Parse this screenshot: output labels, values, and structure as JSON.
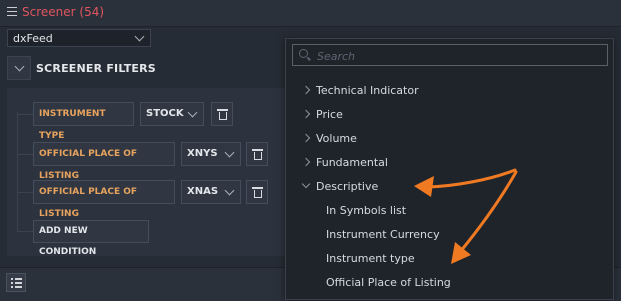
{
  "header": {
    "title": "Screener (54)"
  },
  "source": {
    "selected": "dxFeed"
  },
  "section": {
    "title": "SCREENER FILTERS"
  },
  "conditions": [
    {
      "field": "INSTRUMENT TYPE",
      "value": "STOCK"
    },
    {
      "field": "OFFICIAL PLACE OF LISTING",
      "value": "XNYS"
    },
    {
      "field": "OFFICIAL PLACE OF LISTING",
      "value": "XNAS"
    }
  ],
  "add_condition_label": "ADD NEW CONDITION",
  "dropdown": {
    "search_placeholder": "Search",
    "categories": [
      {
        "label": "Technical Indicator",
        "expanded": false
      },
      {
        "label": "Price",
        "expanded": false
      },
      {
        "label": "Volume",
        "expanded": false
      },
      {
        "label": "Fundamental",
        "expanded": false
      },
      {
        "label": "Descriptive",
        "expanded": true
      }
    ],
    "sub_items": [
      {
        "label": "In Symbols list"
      },
      {
        "label": "Instrument Currency"
      },
      {
        "label": "Instrument type"
      },
      {
        "label": "Official Place of Listing"
      }
    ]
  },
  "colors": {
    "title": "#e0555f",
    "field_label": "#e7a35e",
    "annotation_arrow": "#f07a22"
  },
  "icons": [
    "menu-icon",
    "chevron-down-icon",
    "trash-icon",
    "list-icon",
    "search-icon",
    "chevron-right-icon"
  ]
}
